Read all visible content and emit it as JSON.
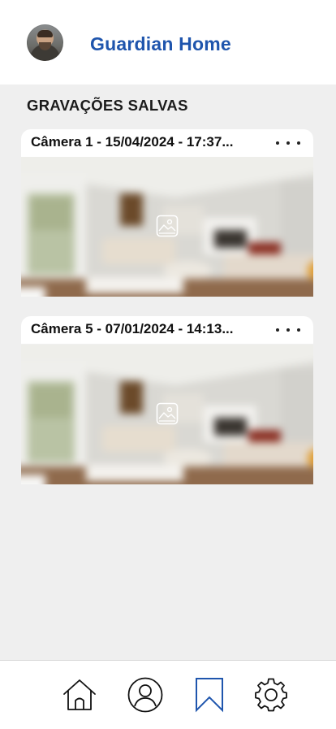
{
  "header": {
    "app_title": "Guardian Home",
    "avatar_alt": "user-avatar"
  },
  "section": {
    "title": "GRAVAÇÕES SALVAS"
  },
  "recordings": [
    {
      "title": "Câmera 1 - 15/04/2024 - 17:37...",
      "more_icon": "more-horizontal-icon",
      "thumbnail_icon": "image-icon"
    },
    {
      "title": "Câmera 5 - 07/01/2024 - 14:13...",
      "more_icon": "more-horizontal-icon",
      "thumbnail_icon": "image-icon"
    }
  ],
  "bottom_nav": {
    "items": [
      {
        "icon": "home-icon",
        "active": false
      },
      {
        "icon": "profile-icon",
        "active": false
      },
      {
        "icon": "bookmark-icon",
        "active": true
      },
      {
        "icon": "settings-icon",
        "active": false
      }
    ]
  },
  "colors": {
    "brand": "#1f55ad",
    "background": "#efefef",
    "surface": "#ffffff",
    "text": "#111111"
  }
}
